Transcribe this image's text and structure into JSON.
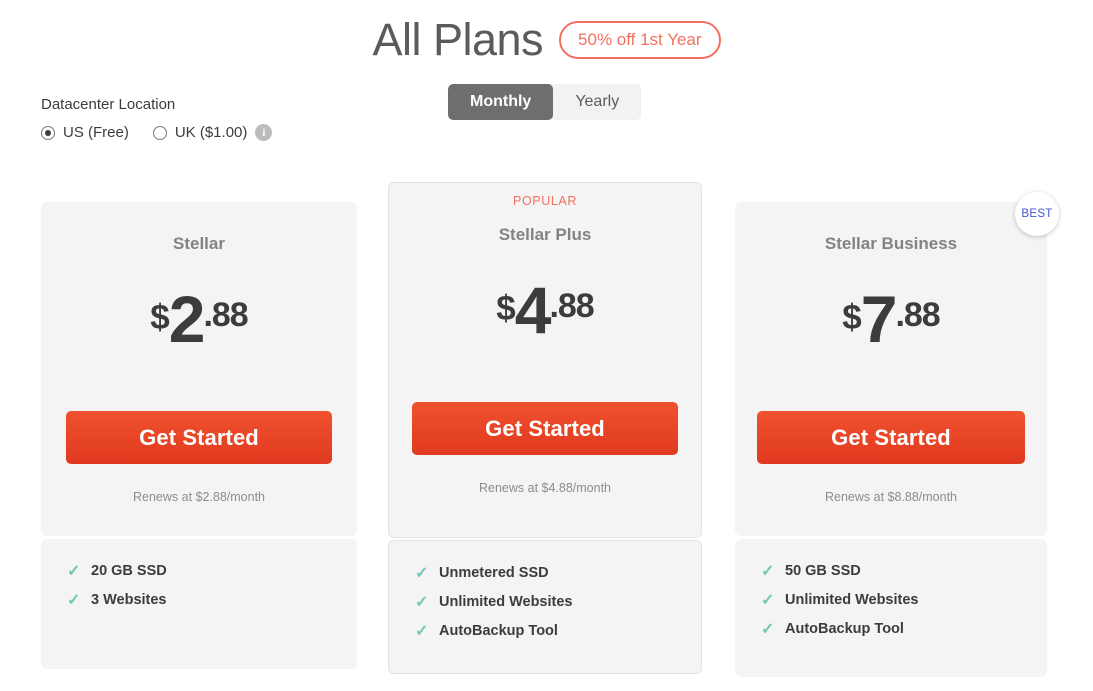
{
  "header": {
    "title": "All Plans",
    "discount_badge": "50% off 1st Year",
    "discount_color": "#f4705f"
  },
  "datacenter": {
    "label": "Datacenter Location",
    "options": [
      {
        "label": "US (Free)",
        "selected": true
      },
      {
        "label": "UK ($1.00)",
        "selected": false
      }
    ],
    "info_icon": "info-icon",
    "info_glyph": "i"
  },
  "billing_cycle": {
    "options": [
      {
        "label": "Monthly",
        "active": true
      },
      {
        "label": "Yearly",
        "active": false
      }
    ],
    "active_bg": "#6e6e6e",
    "inactive_bg": "#f2f2f2"
  },
  "best_badge": {
    "label": "BEST",
    "color": "#4356d6"
  },
  "cta_color": "#e0391f",
  "check_color": "#74c6b6",
  "plans": [
    {
      "tag": "",
      "name": "Stellar",
      "currency": "$",
      "price_whole": "2",
      "price_cents": ".88",
      "cta": "Get Started",
      "renews": "Renews at $2.88/month",
      "features": [
        "20 GB SSD",
        "3 Websites"
      ]
    },
    {
      "tag": "POPULAR",
      "name": "Stellar Plus",
      "currency": "$",
      "price_whole": "4",
      "price_cents": ".88",
      "cta": "Get Started",
      "renews": "Renews at $4.88/month",
      "features": [
        "Unmetered SSD",
        "Unlimited Websites",
        "AutoBackup Tool"
      ]
    },
    {
      "tag": "",
      "name": "Stellar Business",
      "currency": "$",
      "price_whole": "7",
      "price_cents": ".88",
      "cta": "Get Started",
      "renews": "Renews at $8.88/month",
      "features": [
        "50 GB SSD",
        "Unlimited Websites",
        "AutoBackup Tool"
      ]
    }
  ]
}
